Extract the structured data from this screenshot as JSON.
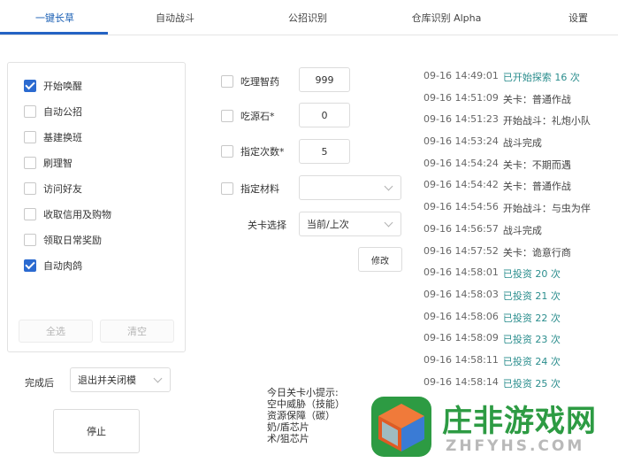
{
  "tabs": [
    {
      "label": "一键长草",
      "active": true
    },
    {
      "label": "自动战斗",
      "active": false
    },
    {
      "label": "公招识别",
      "active": false
    },
    {
      "label": "仓库识别 Alpha",
      "active": false
    },
    {
      "label": "设置",
      "active": false
    }
  ],
  "tasks": [
    {
      "label": "开始唤醒",
      "checked": true
    },
    {
      "label": "自动公招",
      "checked": false
    },
    {
      "label": "基建换班",
      "checked": false
    },
    {
      "label": "刷理智",
      "checked": false
    },
    {
      "label": "访问好友",
      "checked": false
    },
    {
      "label": "收取信用及购物",
      "checked": false
    },
    {
      "label": "领取日常奖励",
      "checked": false
    },
    {
      "label": "自动肉鸽",
      "checked": true
    }
  ],
  "buttons": {
    "select_all": "全选",
    "clear": "清空",
    "stop": "停止",
    "modify": "修改"
  },
  "after_finish": {
    "label": "完成后",
    "value": "退出并关闭模"
  },
  "options": {
    "medicine": {
      "label": "吃理智药",
      "value": "999",
      "checked": false
    },
    "stone": {
      "label": "吃源石*",
      "value": "0",
      "checked": false
    },
    "times": {
      "label": "指定次数*",
      "value": "5",
      "checked": false
    },
    "material": {
      "label": "指定材料",
      "value": "",
      "checked": false
    },
    "stage": {
      "label": "关卡选择",
      "value": "当前/上次"
    }
  },
  "tips": [
    "今日关卡小提示:",
    "空中威胁（技能）",
    "资源保障（碳）",
    "奶/盾芯片",
    "术/狙芯片"
  ],
  "log": [
    {
      "time": "09-16 14:49:01",
      "msg": "已开始探索 16 次",
      "hl": true
    },
    {
      "time": "09-16 14:51:09",
      "msg": "关卡：普通作战",
      "hl": false
    },
    {
      "time": "09-16 14:51:23",
      "msg": "开始战斗：礼炮小队",
      "hl": false
    },
    {
      "time": "09-16 14:53:24",
      "msg": "战斗完成",
      "hl": false
    },
    {
      "time": "09-16 14:54:24",
      "msg": "关卡：不期而遇",
      "hl": false
    },
    {
      "time": "09-16 14:54:42",
      "msg": "关卡：普通作战",
      "hl": false
    },
    {
      "time": "09-16 14:54:56",
      "msg": "开始战斗：与虫为伴",
      "hl": false
    },
    {
      "time": "09-16 14:56:57",
      "msg": "战斗完成",
      "hl": false
    },
    {
      "time": "09-16 14:57:52",
      "msg": "关卡：诡意行商",
      "hl": false
    },
    {
      "time": "09-16 14:58:01",
      "msg": "已投资 20 次",
      "hl": true
    },
    {
      "time": "09-16 14:58:03",
      "msg": "已投资 21 次",
      "hl": true
    },
    {
      "time": "09-16 14:58:06",
      "msg": "已投资 22 次",
      "hl": true
    },
    {
      "time": "09-16 14:58:09",
      "msg": "已投资 23 次",
      "hl": true
    },
    {
      "time": "09-16 14:58:11",
      "msg": "已投资 24 次",
      "hl": true
    },
    {
      "time": "09-16 14:58:14",
      "msg": "已投资 25 次",
      "hl": true
    }
  ],
  "watermark": {
    "name": "庄非游戏网",
    "domain": "ZHFYHS.COM"
  },
  "colors": {
    "accent": "#2463c4",
    "log_highlight": "#2a8d8d",
    "watermark_green": "#2d9b43"
  }
}
